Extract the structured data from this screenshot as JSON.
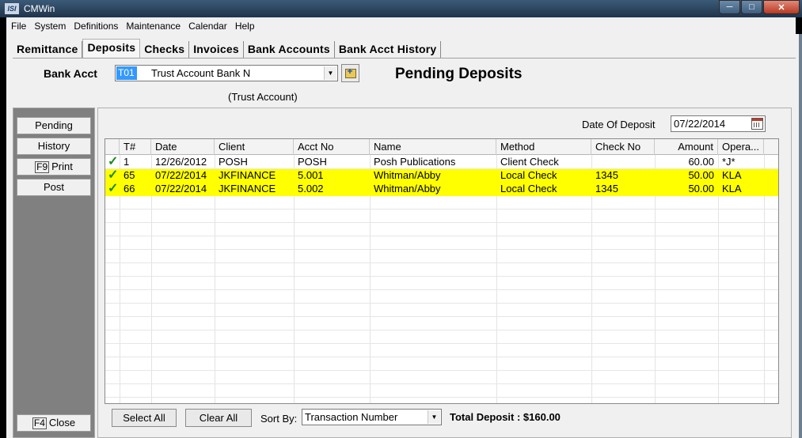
{
  "window": {
    "title": "CMWin",
    "logo": "ISI"
  },
  "menu": [
    "File",
    "System",
    "Definitions",
    "Maintenance",
    "Calendar",
    "Help"
  ],
  "tabs": [
    "Remittance",
    "Deposits",
    "Checks",
    "Invoices",
    "Bank Accounts",
    "Bank Acct History"
  ],
  "active_tab": "Deposits",
  "bank": {
    "label": "Bank Acct",
    "code": "T01",
    "name": "Trust Account Bank N",
    "type": "(Trust Account)"
  },
  "page_title": "Pending Deposits",
  "sidebar": {
    "pending": "Pending",
    "history": "History",
    "print_key": "F9",
    "print": "Print",
    "post": "Post",
    "close_key": "F4",
    "close": "Close"
  },
  "deposit_date": {
    "label": "Date Of Deposit",
    "value": "07/22/2014"
  },
  "grid": {
    "columns": [
      "",
      "T#",
      "Date",
      "Client",
      "Acct No",
      "Name",
      "Method",
      "Check No",
      "Amount",
      "Opera..."
    ],
    "rows": [
      {
        "check": "✓",
        "t": "1",
        "date": "12/26/2012",
        "client": "POSH",
        "acct": "POSH",
        "name": "Posh Publications",
        "method": "Client Check",
        "checkno": "",
        "amount": "60.00",
        "op": "*J*",
        "highlight": false
      },
      {
        "check": "✓",
        "t": "65",
        "date": "07/22/2014",
        "client": "JKFINANCE",
        "acct": "5.001",
        "name": "Whitman/Abby",
        "method": "Local Check",
        "checkno": "1345",
        "amount": "50.00",
        "op": "KLA",
        "highlight": true
      },
      {
        "check": "✓",
        "t": "66",
        "date": "07/22/2014",
        "client": "JKFINANCE",
        "acct": "5.002",
        "name": "Whitman/Abby",
        "method": "Local Check",
        "checkno": "1345",
        "amount": "50.00",
        "op": "KLA",
        "highlight": true
      }
    ]
  },
  "bottom": {
    "select_all": "Select All",
    "clear_all": "Clear All",
    "sort_label": "Sort By:",
    "sort_value": "Transaction Number",
    "total": "Total Deposit : $160.00"
  },
  "colors": {
    "highlight": "#ffff00",
    "selection": "#3399ff",
    "check": "#1d8a1d"
  },
  "icons": [
    "app-logo-icon",
    "minimize-icon",
    "maximize-icon",
    "close-icon",
    "dropdown-arrow-icon",
    "open-folder-icon",
    "calendar-icon",
    "checkmark-icon"
  ]
}
